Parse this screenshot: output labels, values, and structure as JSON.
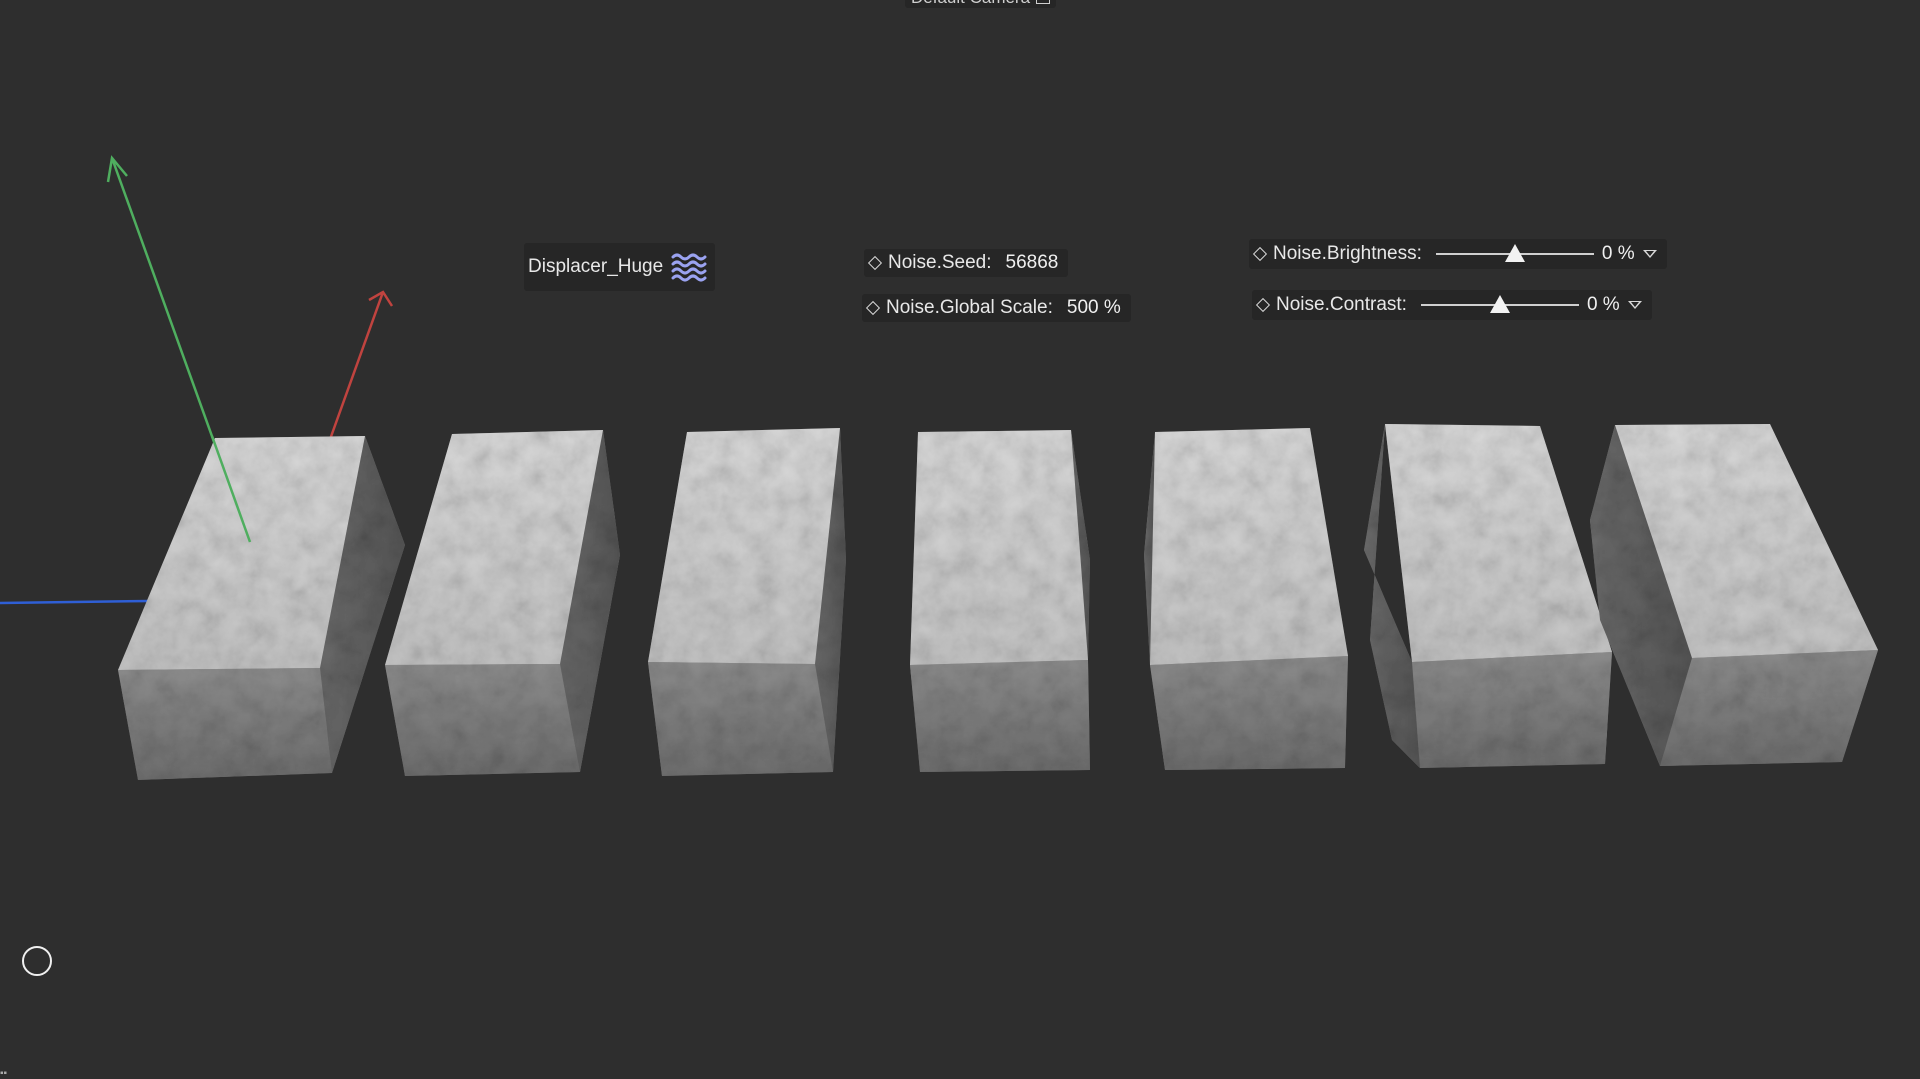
{
  "viewport": {
    "camera_label": "Default Camera",
    "background": "#2e2e2e",
    "axis_colors": {
      "x": "#c0433f",
      "y": "#4fae5f",
      "z": "#2f5fd6"
    },
    "object_count": 7
  },
  "deformer_tag": {
    "name": "Displacer_Huge",
    "icon": "displacer-waves-icon",
    "icon_color": "#9aa2f0"
  },
  "params": {
    "noise_seed": {
      "label": "Noise.Seed:",
      "value": "56868"
    },
    "noise_global_scale": {
      "label": "Noise.Global Scale:",
      "value": "500 %"
    },
    "noise_brightness": {
      "label": "Noise.Brightness:",
      "value": "0 %",
      "slider_level": 0.5
    },
    "noise_contrast": {
      "label": "Noise.Contrast:",
      "value": "0 %",
      "slider_level": 0.5
    }
  }
}
